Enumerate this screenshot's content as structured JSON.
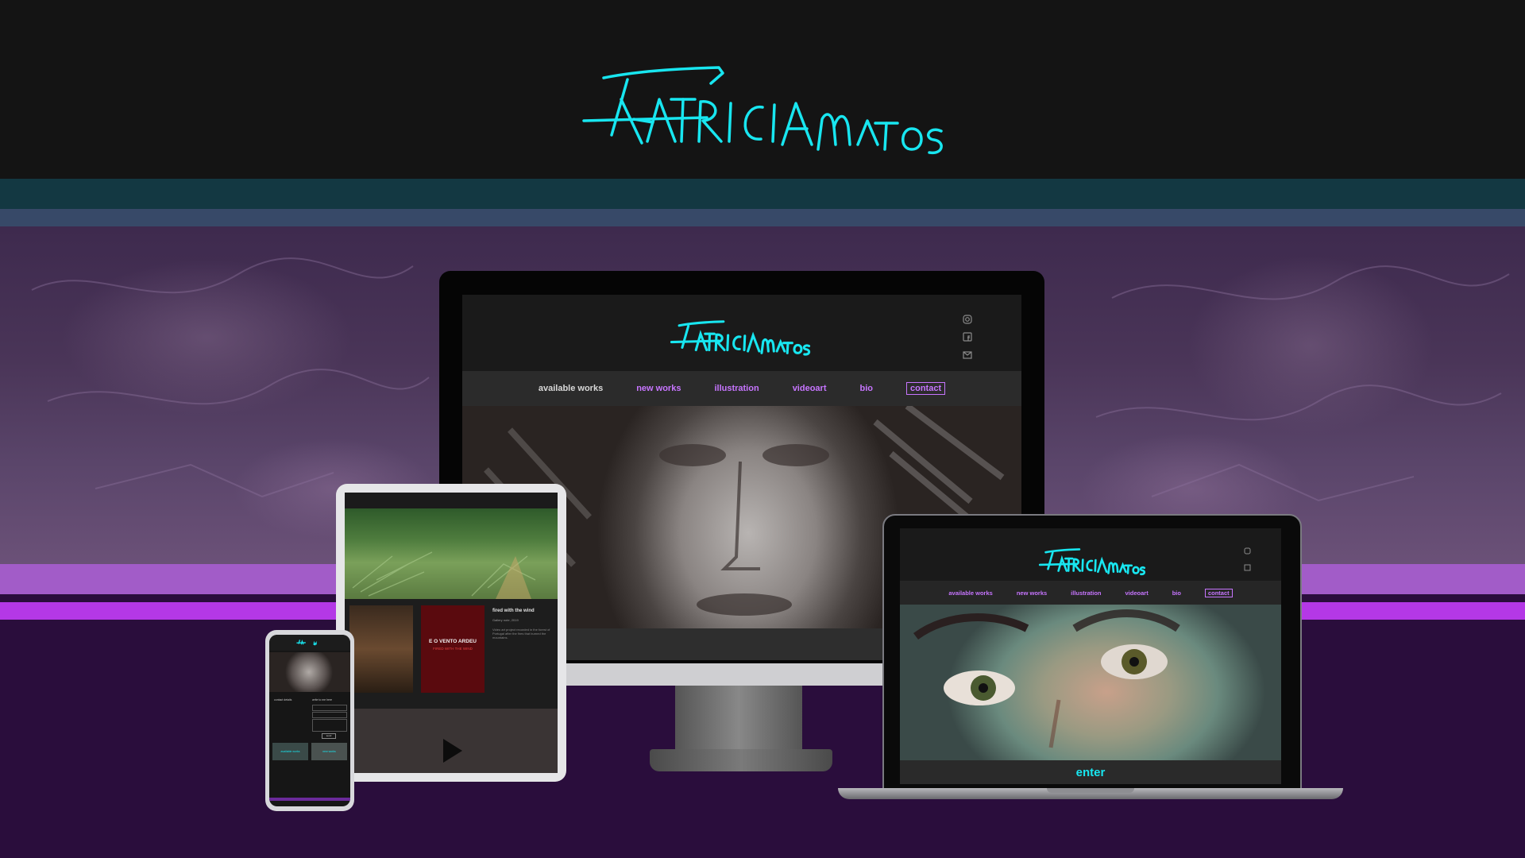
{
  "brand": {
    "signature": "Patricia Matos",
    "accent": "#18e6f0",
    "nav_accent": "#c775ff"
  },
  "desktop_site": {
    "nav": [
      "available works",
      "new works",
      "illustration",
      "videoart",
      "bio",
      "contact"
    ],
    "social_icons": [
      "instagram-icon",
      "facebook-icon",
      "mail-icon"
    ]
  },
  "laptop_site": {
    "nav": [
      "available works",
      "new works",
      "illustration",
      "videoart",
      "bio",
      "contact"
    ],
    "enter_label": "enter"
  },
  "tablet_site": {
    "post_title": "fired with the wind",
    "post_meta": "Gallery note, 2019",
    "post_body": "Video art project recorded in the forest of Portugal after the fires that burned the mountains.",
    "poster_title": "E O VENTO ARDEU",
    "poster_subtitle": "FIRED WITH THE WIND"
  },
  "phone_site": {
    "col_left": "contact details",
    "col_right": "write to me here",
    "send_label": "send",
    "tile_left": "available works",
    "tile_right": "new works"
  }
}
